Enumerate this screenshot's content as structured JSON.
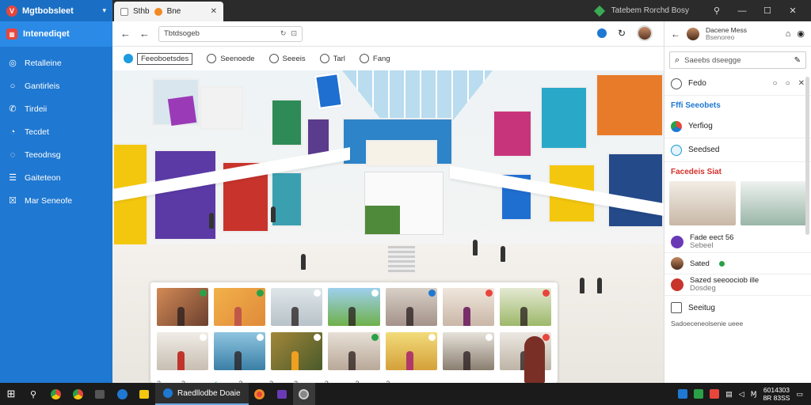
{
  "colors": {
    "sidebar": "#1f78d1",
    "accent": "#1f78d1",
    "danger": "#e8453c",
    "success": "#2aa147"
  },
  "sidebar": {
    "title": "Mgtbobsleet",
    "active_item": "Intenediqet",
    "items": [
      {
        "label": "Retalleine",
        "icon": "globe-icon"
      },
      {
        "label": "Gantirleis",
        "icon": "circle-icon"
      },
      {
        "label": "Tirdeii",
        "icon": "phone-icon"
      },
      {
        "label": "Tecdet",
        "icon": "clock-icon"
      },
      {
        "label": "Teeodnsg",
        "icon": "chat-icon"
      },
      {
        "label": "Gaiteteon",
        "icon": "list-icon"
      },
      {
        "label": "Mar Seneofe",
        "icon": "close-box-icon"
      }
    ]
  },
  "browser": {
    "tab_title": "Sthb",
    "tab_label2": "Bne",
    "window_title": "Tatebem Rorchd Bosy",
    "url": "Tbtdsogeb",
    "toolbar": [
      {
        "label": "Feeoboetsdes",
        "icon": "compass-icon"
      },
      {
        "label": "Seenoede",
        "icon": "chat-icon"
      },
      {
        "label": "Seeeis",
        "icon": "tag-icon"
      },
      {
        "label": "Tarl",
        "icon": "send-icon"
      },
      {
        "label": "Fang",
        "icon": "globe-icon"
      }
    ]
  },
  "gallery": {
    "footer": [
      "3",
      "3 ~",
      "✓",
      "3 ~",
      "3",
      "3 ~",
      "3 ~",
      "3 ~",
      "3 ~"
    ]
  },
  "right_panel": {
    "profile_name": "Dacene Mess",
    "profile_sub": "Bsenoreo",
    "search_placeholder": "Saeebs dseegge",
    "feed_label": "Fedo",
    "section_blue": "Fffi Seeobets",
    "rows": [
      {
        "label": "Yerfiog"
      },
      {
        "label": "Seedsed"
      }
    ],
    "section_red": "Facedeis Siat",
    "contacts": [
      {
        "name": "Fade eect 56",
        "sub": "Sebeel"
      },
      {
        "name": "Sated",
        "sub": ""
      },
      {
        "name": "Sazed seeoociob ille",
        "sub": "Dosdeg"
      }
    ],
    "bottom_label": "Seeitug",
    "bottom_sub": "Sadoeceneolsenie ueee"
  },
  "taskbar": {
    "app_label": "Raedllodbe Doaie",
    "clock_top": "6014303",
    "clock_bottom": "8R 83SS"
  }
}
